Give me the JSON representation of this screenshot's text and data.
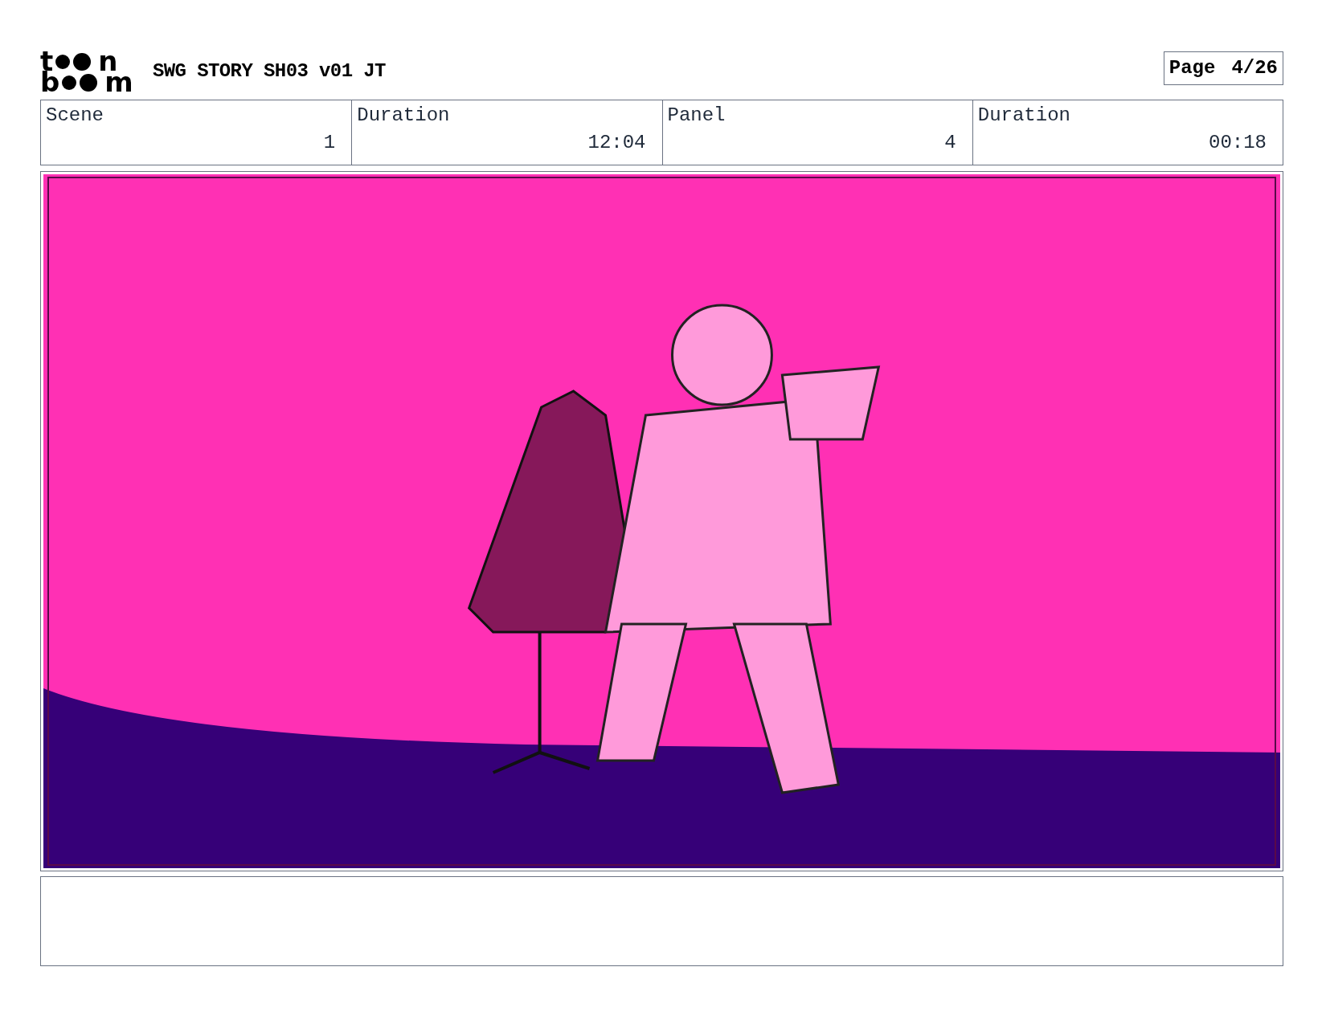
{
  "logo": {
    "rows": [
      {
        "first": "t",
        "last": "n"
      },
      {
        "first": "b",
        "last": "m"
      }
    ]
  },
  "title": "SWG STORY SH03 v01 JT",
  "page": {
    "label": "Page",
    "value": "4/26"
  },
  "fields": [
    {
      "label": "Scene",
      "value": "1"
    },
    {
      "label": "Duration",
      "value": "12:04"
    },
    {
      "label": "Panel",
      "value": "4"
    },
    {
      "label": "Duration",
      "value": "00:18"
    }
  ]
}
